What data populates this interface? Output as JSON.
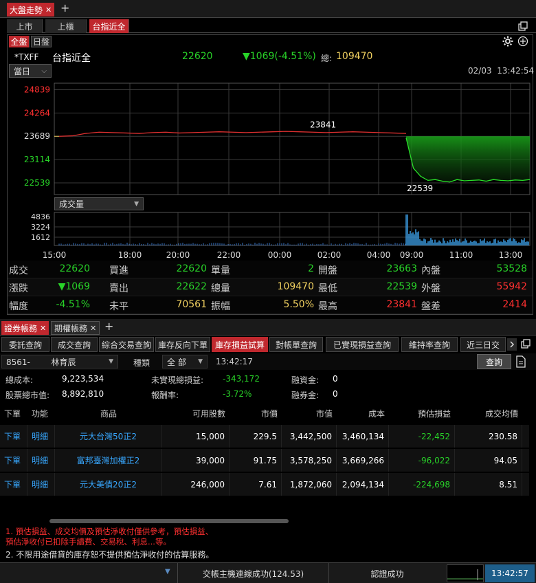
{
  "top_tabs": {
    "market_tab": "大盤走勢",
    "close": "✕",
    "add": "+"
  },
  "sub_tabs": [
    "上市",
    "上櫃",
    "台指近全"
  ],
  "mode_tabs": [
    "全盤",
    "日盤"
  ],
  "quote_header": {
    "symbol": "*TXFF",
    "name": "台指近全",
    "price": "22620",
    "change": "▼1069(-4.51%)",
    "total_label": "總:",
    "total": "109470",
    "period": "當日",
    "datetime": "02/03  13:42:54"
  },
  "chart_data": {
    "type": "line",
    "ylim": [
      22250,
      25000
    ],
    "yticks": [
      "24839",
      "24264",
      "23689",
      "23114",
      "22539"
    ],
    "xticks": [
      "15:00",
      "18:00",
      "20:00",
      "22:00",
      "00:00",
      "02:00",
      "04:00",
      "09:00",
      "11:00",
      "13:00"
    ],
    "ref_price": 23689,
    "high_label": "23841",
    "low_label": "22539",
    "night_session": [
      23689,
      23700,
      23760,
      23790,
      23780,
      23770,
      23760,
      23780,
      23790,
      23770,
      23780,
      23790,
      23800,
      23790,
      23780,
      23790,
      23800,
      23810,
      23800,
      23790,
      23780,
      23790,
      23800,
      23790,
      23780,
      23770,
      23760
    ],
    "day_session": [
      23650,
      22900,
      22700,
      22600,
      22620,
      22580,
      22560,
      22620,
      22590,
      22600,
      22610,
      22580,
      22620,
      22600,
      22590,
      22610,
      22600,
      22620
    ],
    "volume_label": "成交量",
    "volume_ticks": [
      "4836",
      "3224",
      "1612"
    ]
  },
  "stats": {
    "rows": [
      [
        {
          "l": "成交",
          "v": "22620",
          "c": "green"
        },
        {
          "l": "買進",
          "v": "22620",
          "c": "green"
        },
        {
          "l": "單量",
          "v": "2",
          "c": "green"
        },
        {
          "l": "開盤",
          "v": "23663",
          "c": "green"
        },
        {
          "l": "內盤",
          "v": "53528",
          "c": "green"
        }
      ],
      [
        {
          "l": "漲跌",
          "v": "▼1069",
          "c": "green"
        },
        {
          "l": "賣出",
          "v": "22622",
          "c": "green"
        },
        {
          "l": "總量",
          "v": "109470",
          "c": "yellow"
        },
        {
          "l": "最低",
          "v": "22539",
          "c": "green"
        },
        {
          "l": "外盤",
          "v": "55942",
          "c": "red"
        }
      ],
      [
        {
          "l": "幅度",
          "v": "-4.51%",
          "c": "green"
        },
        {
          "l": "未平",
          "v": "70561",
          "c": "yellow"
        },
        {
          "l": "振幅",
          "v": "5.50%",
          "c": "yellow"
        },
        {
          "l": "最高",
          "v": "23841",
          "c": "red"
        },
        {
          "l": "盤差",
          "v": "2414",
          "c": "red"
        }
      ]
    ]
  },
  "account_tabs": {
    "securities": "證券帳務",
    "futures": "期權帳務",
    "add": "+"
  },
  "function_tabs": [
    "委託查詢",
    "成交查詢",
    "綜合交易查詢",
    "庫存反向下單",
    "庫存損益試算",
    "對帳單查詢",
    "已實現損益查詢",
    "維持率查詢",
    "近三日交"
  ],
  "filter": {
    "account": "8561-        林育辰",
    "type_label": "種類",
    "type_value": "全 部",
    "time": "13:42:17",
    "query_button": "查詢"
  },
  "summary": {
    "total_cost_label": "總成本:",
    "total_cost": "9,223,534",
    "unrealized_label": "未實現總損益:",
    "unrealized": "-343,172",
    "margin_label": "融資金:",
    "margin": "0",
    "market_value_label": "股票總市值:",
    "market_value": "8,892,810",
    "return_label": "報酬率:",
    "return": "-3.72%",
    "short_label": "融券金:",
    "short": "0"
  },
  "table": {
    "headers": [
      "下單",
      "功能",
      "商品",
      "可用股數",
      "市價",
      "市值",
      "成本",
      "預估損益",
      "成交均價"
    ],
    "rows": [
      [
        "下單",
        "明細",
        "元大台灣50正2",
        "15,000",
        "229.5",
        "3,442,500",
        "3,460,134",
        "-22,452",
        "230.58"
      ],
      [
        "下單",
        "明細",
        "富邦臺灣加權正2",
        "39,000",
        "91.75",
        "3,578,250",
        "3,669,266",
        "-96,022",
        "94.05"
      ],
      [
        "下單",
        "明細",
        "元大美債20正2",
        "246,000",
        "7.61",
        "1,872,060",
        "2,094,134",
        "-224,698",
        "8.51"
      ]
    ]
  },
  "notes": {
    "note1_line1": "1. 預估損益、成交均價及預估淨收付僅供參考，預估損益、",
    "note1_line2": "預估淨收付已扣除手續費、交易稅、利息...等。",
    "note2": "2. 不限用途借貸的庫存恕不提供預估淨收付的估算服務。"
  },
  "status": {
    "connection": "交帳主機連線成功(124.53)",
    "auth": "認證成功",
    "clock": "13:42:57"
  },
  "colors": {
    "accent": "#c0282e",
    "up": "#ff3030",
    "down": "#28d228",
    "neutral": "#f0d060",
    "link": "#38a8ff"
  }
}
